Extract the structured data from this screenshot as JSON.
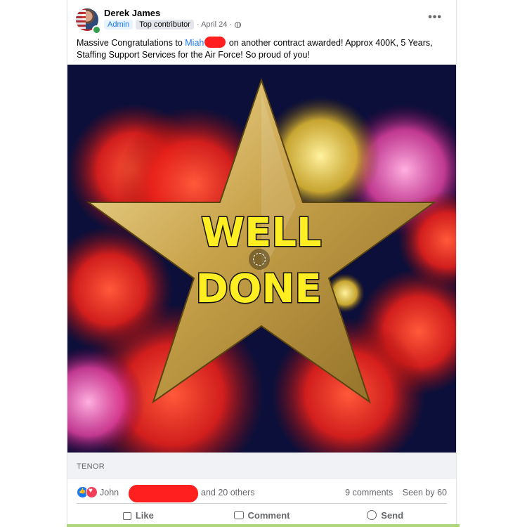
{
  "post": {
    "author": "Derek James",
    "badges": {
      "admin": "Admin",
      "top": "Top contributor"
    },
    "date": "· April 24 ·",
    "text_part1": "Massive Congratulations to ",
    "mention": "Miah",
    "text_part2": " on another contract awarded! Approx 400K, 5 Years, Staffing Support Services for the Air Force! So proud of you!"
  },
  "media": {
    "line1": "WELL",
    "line2": "DONE",
    "source": "TENOR"
  },
  "reactions": {
    "name": "John",
    "others": "and 20 others",
    "comments": "9 comments",
    "seen": "Seen by 60"
  },
  "actions": {
    "like": "Like",
    "comment": "Comment",
    "send": "Send"
  },
  "colors": {
    "accent": "#1877f2",
    "redaction": "#ff1f1f",
    "star": "#c8a24a",
    "star_text": "#ffee22"
  }
}
